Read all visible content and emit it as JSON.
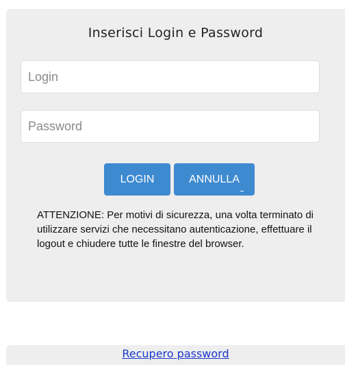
{
  "login_form": {
    "title": "Inserisci Login e Password",
    "login_placeholder": "Login",
    "login_value": "",
    "password_placeholder": "Password",
    "password_value": "",
    "login_button_label": "LOGIN",
    "cancel_button_label": "ANNULLA",
    "notice_text": "ATTENZIONE: Per motivi di sicurezza, una volta terminato di utilizzare servizi che necessitano autenticazione, effettuare il logout e chiudere tutte le finestre del browser."
  },
  "recovery": {
    "link_label": "Recupero password"
  },
  "colors": {
    "panel_background": "#eeeeee",
    "button_background": "#3e8ad0",
    "link_color": "#1a37c9"
  }
}
